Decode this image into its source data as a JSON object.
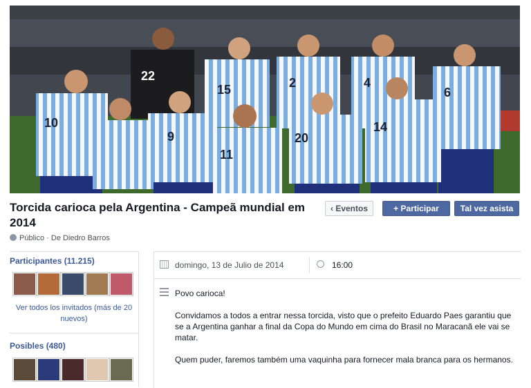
{
  "event": {
    "title": "Torcida carioca pela Argentina - Campeã mundial em 2014",
    "privacy": "Público",
    "separator": "·",
    "host": "De Diedro Barros",
    "date": "domingo, 13 de Julio de 2014",
    "time": "16:00"
  },
  "actions": {
    "eventos": "Eventos",
    "participar": "Participar",
    "talvez": "Tal vez asista"
  },
  "sidebar": {
    "participants_title": "Participantes (11.215)",
    "view_all": "Ver todos los invitados (más de 20 nuevos)",
    "posibles_title": "Posibles (480)"
  },
  "description": [
    "Povo carioca!",
    "Convidamos a todos a entrar nessa torcida, visto que o prefeito Eduardo Paes garantiu que se a Argentina ganhar a final da Copa do Mundo em cima do Brasil no Maracanã ele vai se matar.",
    "Quem puder, faremos também uma vaquinha para fornecer mala branca para os hermanos."
  ],
  "cover": {
    "jersey_numbers": [
      "22",
      "15",
      "2",
      "4",
      "6",
      "10",
      "9",
      "11",
      "20",
      "14"
    ]
  },
  "colors": {
    "link": "#3b5998",
    "primary_button": "#4e69a2",
    "jersey_blue": "#7aaee0",
    "shorts": "#1f2f7a"
  }
}
